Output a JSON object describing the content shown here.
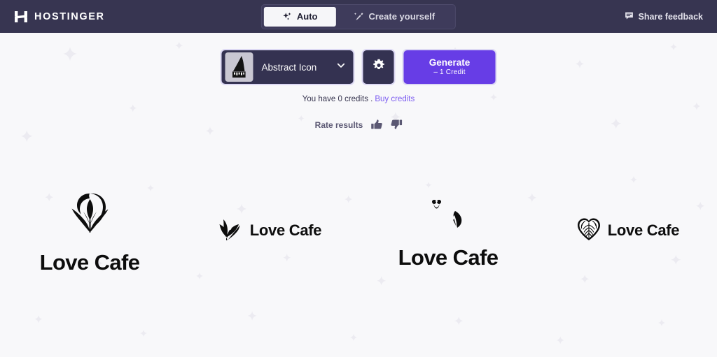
{
  "header": {
    "brand": "HOSTINGER",
    "brand_icon": "hostinger-h-icon",
    "tabs": [
      {
        "label": "Auto",
        "icon": "sparkles-icon",
        "active": true
      },
      {
        "label": "Create yourself",
        "icon": "magic-wand-icon",
        "active": false
      }
    ],
    "feedback": {
      "label": "Share feedback",
      "icon": "speech-bubble-icon"
    },
    "bar_color": "#373551"
  },
  "controls": {
    "style_select": {
      "value": "Abstract Icon",
      "thumbnail_icon": "abstract-cone-icon",
      "chevron_icon": "chevron-down-icon"
    },
    "settings": {
      "icon": "gear-icon"
    },
    "generate": {
      "label": "Generate",
      "cost": "– 1 Credit",
      "color": "#673de6"
    }
  },
  "credits": {
    "text": "You have 0 credits .",
    "link_label": "Buy credits",
    "link_color": "#7c5cf0"
  },
  "rate": {
    "label": "Rate results",
    "thumbs_up_icon": "thumbs-up-icon",
    "thumbs_down_icon": "thumbs-down-icon"
  },
  "results": [
    {
      "name": "Love Cafe",
      "layout": "vertical",
      "mark": "heart-leaf-outline-icon",
      "size": "large"
    },
    {
      "name": "Love Cafe",
      "layout": "horizontal",
      "mark": "foliage-sprig-icon",
      "size": "small"
    },
    {
      "name": "Love Cafe",
      "layout": "vertical",
      "mark": "abstract-dual-mark-icon",
      "size": "large"
    },
    {
      "name": "Love Cafe",
      "layout": "horizontal",
      "mark": "heart-veins-icon",
      "size": "small"
    }
  ],
  "background": {
    "color": "#f8f8fa",
    "sparkle_color": "#edecf1"
  }
}
